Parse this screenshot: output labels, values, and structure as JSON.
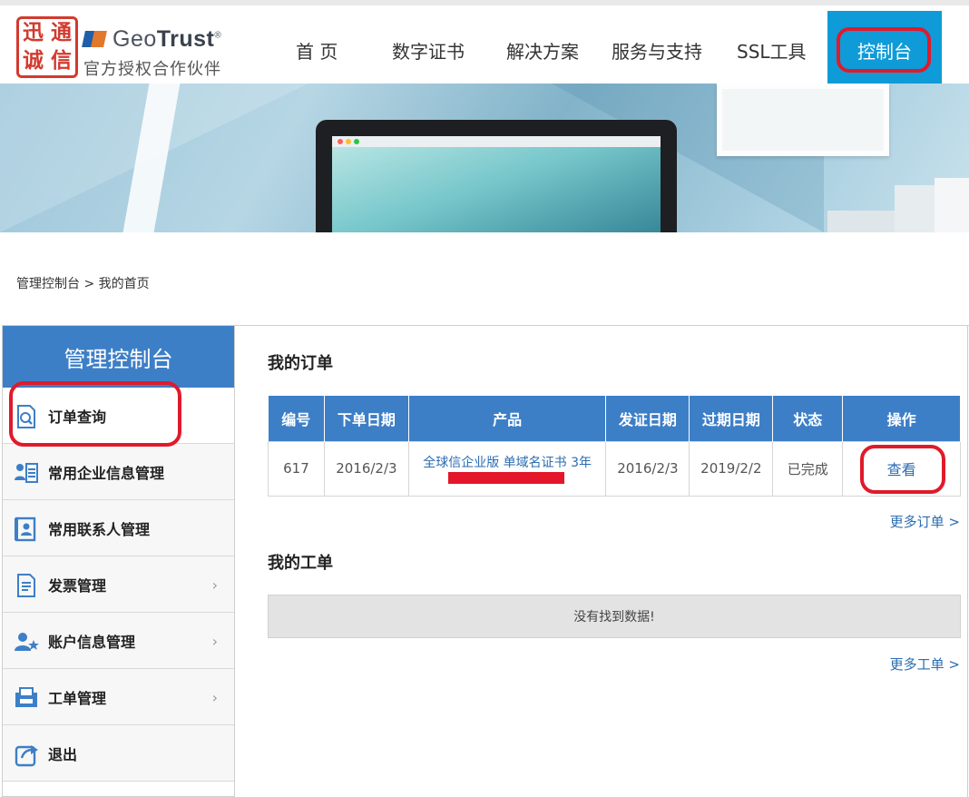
{
  "header": {
    "seal_chars": [
      "迅",
      "通",
      "诚",
      "信"
    ],
    "brand_prefix": "Geo",
    "brand_bold": "Trust",
    "brand_mark": "®",
    "subtitle": "官方授权合作伙伴",
    "nav": {
      "home": "首 页",
      "certs": "数字证书",
      "solutions": "解决方案",
      "support": "服务与支持",
      "ssl_tools": "SSL工具",
      "console": "控制台"
    }
  },
  "breadcrumb": "管理控制台 > 我的首页",
  "sidebar": {
    "title": "管理控制台",
    "items": [
      {
        "label": "订单查询",
        "icon": "order-search-icon",
        "has_arrow": false
      },
      {
        "label": "常用企业信息管理",
        "icon": "company-info-icon",
        "has_arrow": false
      },
      {
        "label": "常用联系人管理",
        "icon": "contacts-icon",
        "has_arrow": false
      },
      {
        "label": "发票管理",
        "icon": "invoice-icon",
        "has_arrow": true
      },
      {
        "label": "账户信息管理",
        "icon": "account-star-icon",
        "has_arrow": true
      },
      {
        "label": "工单管理",
        "icon": "ticket-icon",
        "has_arrow": true
      },
      {
        "label": "退出",
        "icon": "logout-icon",
        "has_arrow": false
      }
    ],
    "arrow": "›"
  },
  "orders": {
    "title": "我的订单",
    "columns": [
      "编号",
      "下单日期",
      "产品",
      "发证日期",
      "过期日期",
      "状态",
      "操作"
    ],
    "rows": [
      {
        "id": "617",
        "order_date": "2016/2/3",
        "product": "全球信企业版 单域名证书 3年",
        "issue_date": "2016/2/3",
        "expire_date": "2019/2/2",
        "status": "已完成",
        "action": "查看"
      }
    ],
    "more": "更多订单 >"
  },
  "tickets": {
    "title": "我的工单",
    "empty": "没有找到数据!",
    "more": "更多工单 >"
  },
  "colors": {
    "primary_blue": "#3d7fc7",
    "nav_active": "#0e9bd8",
    "annotation_red": "#e01a2a",
    "link_blue": "#2b6cb0"
  }
}
